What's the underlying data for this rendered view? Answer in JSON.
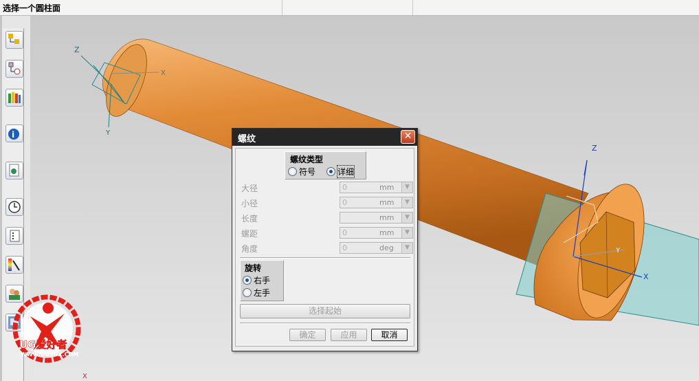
{
  "status_bar": {
    "prompt": "选择一个圆柱面"
  },
  "toolbar": {
    "icons": [
      "assembly-navigator-icon",
      "part-navigator-icon",
      "reuse-library-icon",
      "web-browser-icon",
      "history-icon",
      "process-studio-icon",
      "visualization-icon",
      "roles-icon",
      "system-materials-icon"
    ]
  },
  "viewport": {
    "axis_labels": {
      "z_top": "Z",
      "x_top": "X",
      "y_top": "Y",
      "z_right": "Z",
      "x_right": "X",
      "y_right": "Y",
      "x_bottom": "X"
    },
    "colors": {
      "cylinder": "#e08a33",
      "plane": "#7fcfcf",
      "axis": "#1a3db8",
      "triad": "#1f7f7f"
    }
  },
  "dialog": {
    "title": "螺纹",
    "close_glyph": "✕",
    "thread_type": {
      "title": "螺纹类型",
      "options": [
        {
          "label": "符号",
          "selected": false
        },
        {
          "label": "详细",
          "selected": true
        }
      ]
    },
    "fields": [
      {
        "label": "大径",
        "value": "0",
        "unit": "mm"
      },
      {
        "label": "小径",
        "value": "0",
        "unit": "mm"
      },
      {
        "label": "长度",
        "value": "",
        "unit": "mm"
      },
      {
        "label": "螺距",
        "value": "0",
        "unit": "mm"
      },
      {
        "label": "角度",
        "value": "0",
        "unit": "deg"
      }
    ],
    "rotation": {
      "title": "旋转",
      "options": [
        {
          "label": "右手",
          "selected": true
        },
        {
          "label": "左手",
          "selected": false
        }
      ]
    },
    "select_start_label": "选择起始",
    "ok_label": "确定",
    "apply_label": "应用",
    "cancel_label": "取消"
  },
  "watermark": {
    "brand": "UG爱好者",
    "url": "WWW.UGSNX.COM",
    "accent": "#e0201a"
  }
}
